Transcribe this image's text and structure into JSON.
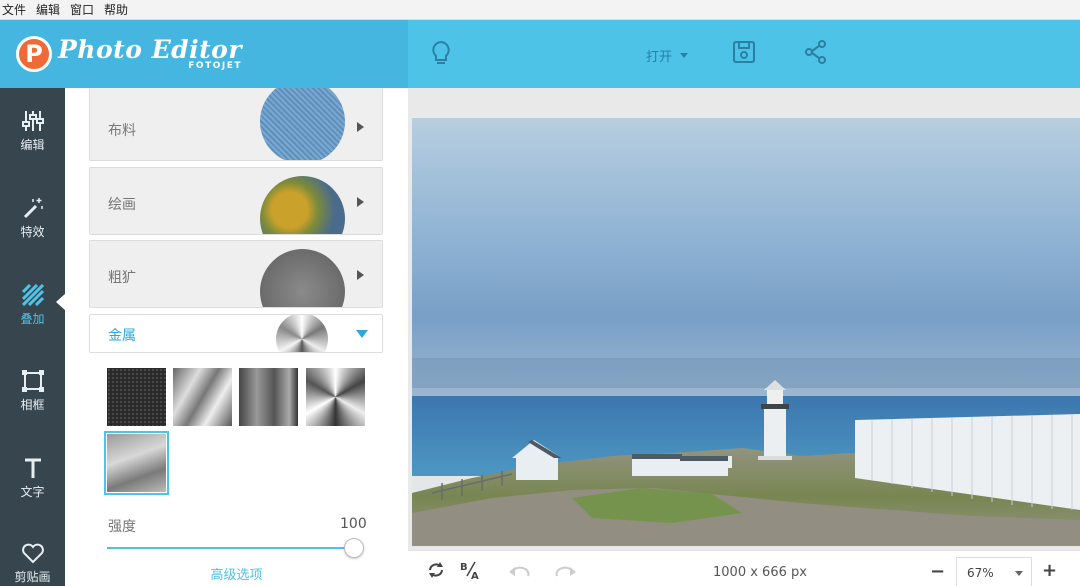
{
  "menu": [
    "文件",
    "编辑",
    "窗口",
    "帮助"
  ],
  "logo": {
    "letter": "P",
    "title": "Photo Editor",
    "subtitle": "FOTOJET"
  },
  "topbar": {
    "open_label": "打开"
  },
  "nav": [
    {
      "label": "编辑",
      "icon": "sliders-icon"
    },
    {
      "label": "特效",
      "icon": "magic-wand-icon"
    },
    {
      "label": "叠加",
      "icon": "overlay-stripes-icon",
      "active": true
    },
    {
      "label": "相框",
      "icon": "frame-icon"
    },
    {
      "label": "文字",
      "icon": "text-icon"
    },
    {
      "label": "剪贴画",
      "icon": "heart-icon"
    }
  ],
  "overlays": [
    {
      "label": "布料"
    },
    {
      "label": "绘画"
    },
    {
      "label": "粗犷"
    }
  ],
  "metal": {
    "label": "金属",
    "swatches": 5,
    "selected_index": 4
  },
  "intensity": {
    "label": "强度",
    "value": "100",
    "fraction": 1.0
  },
  "advanced_label": "高级选项",
  "canvas": {
    "dimensions": "1000 x 666 px"
  },
  "zoom": {
    "value": "67%"
  },
  "colors": {
    "accent": "#4ec3e8",
    "header": "#45b6e0",
    "nav_bg": "#37454f",
    "logo": "#f06a35"
  }
}
